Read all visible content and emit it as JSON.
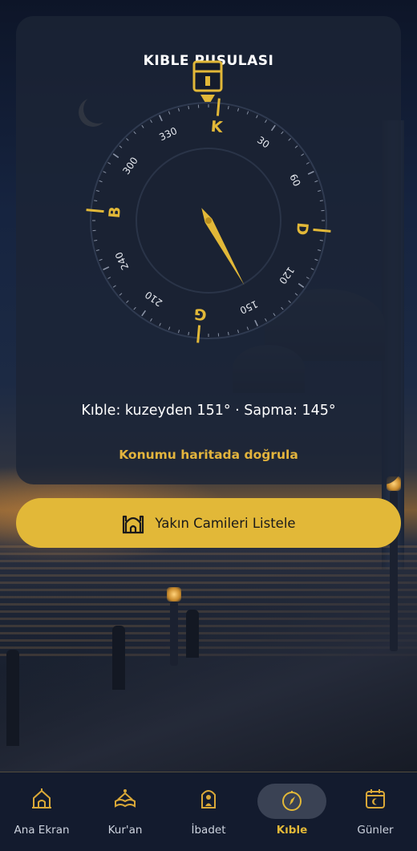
{
  "card": {
    "title": "KIBLE PUSULASI",
    "qibla_info": "Kıble: kuzeyden 151° · Sapma: 145°",
    "map_link": "Konumu haritada doğrula"
  },
  "compass": {
    "cardinals": {
      "north": "K",
      "east": "D",
      "south": "G",
      "west": "B"
    },
    "degree_labels": [
      "30",
      "60",
      "120",
      "150",
      "210",
      "240",
      "300",
      "330"
    ],
    "needle_bearing_deg": 151,
    "rotation_deg": 5,
    "accent_color": "#e2b838"
  },
  "action_button": {
    "label": "Yakın Camileri Listele",
    "icon": "mosque-icon"
  },
  "nav": {
    "items": [
      {
        "label": "Ana Ekran",
        "icon": "home-mosque-icon"
      },
      {
        "label": "Kur'an",
        "icon": "quran-icon"
      },
      {
        "label": "İbadet",
        "icon": "prayer-icon"
      },
      {
        "label": "Kıble",
        "icon": "compass-icon"
      },
      {
        "label": "Günler",
        "icon": "calendar-icon"
      }
    ],
    "active": "Kıble"
  }
}
